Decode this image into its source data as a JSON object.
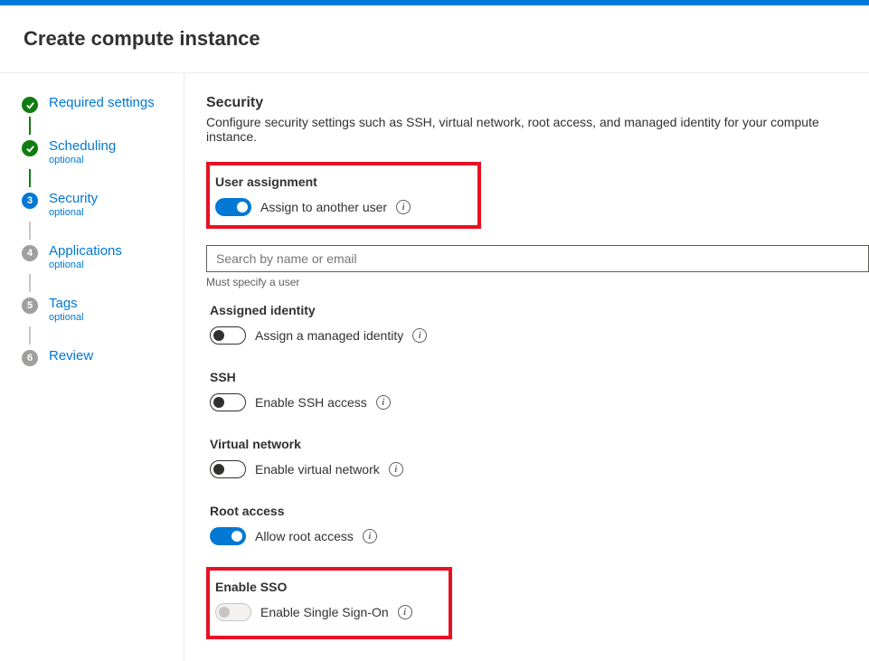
{
  "pageTitle": "Create compute instance",
  "sidebar": {
    "steps": [
      {
        "label": "Required settings",
        "sub": "",
        "state": "completed"
      },
      {
        "label": "Scheduling",
        "sub": "optional",
        "state": "completed"
      },
      {
        "label": "Security",
        "sub": "optional",
        "state": "current",
        "num": "3"
      },
      {
        "label": "Applications",
        "sub": "optional",
        "state": "pending",
        "num": "4"
      },
      {
        "label": "Tags",
        "sub": "optional",
        "state": "pending",
        "num": "5"
      },
      {
        "label": "Review",
        "sub": "",
        "state": "pending",
        "num": "6"
      }
    ]
  },
  "main": {
    "title": "Security",
    "desc": "Configure security settings such as SSH, virtual network, root access, and managed identity for your compute instance.",
    "userAssign": {
      "heading": "User assignment",
      "toggleLabel": "Assign to another user",
      "searchPlaceholder": "Search by name or email",
      "helper": "Must specify a user"
    },
    "identity": {
      "heading": "Assigned identity",
      "toggleLabel": "Assign a managed identity"
    },
    "ssh": {
      "heading": "SSH",
      "toggleLabel": "Enable SSH access"
    },
    "vnet": {
      "heading": "Virtual network",
      "toggleLabel": "Enable virtual network"
    },
    "root": {
      "heading": "Root access",
      "toggleLabel": "Allow root access"
    },
    "sso": {
      "heading": "Enable SSO",
      "toggleLabel": "Enable Single Sign-On"
    }
  }
}
